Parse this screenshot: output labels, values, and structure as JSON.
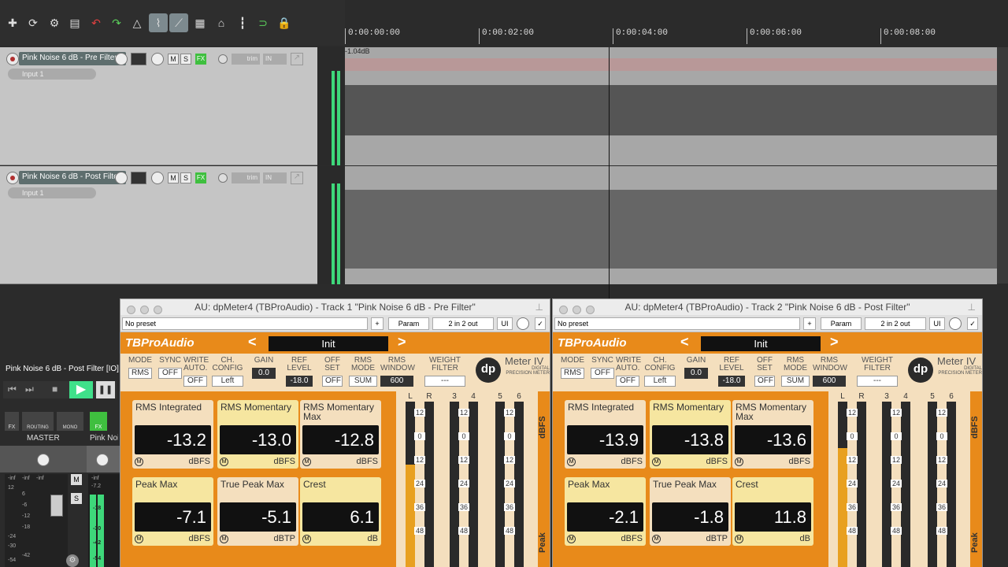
{
  "timeline": {
    "ticks": [
      "0:00:00:00",
      "0:00:02:00",
      "0:00:04:00",
      "0:00:06:00",
      "0:00:08:00"
    ],
    "peak_label": "-1.04dB"
  },
  "tracks": [
    {
      "name": "Pink Noise 6 dB - Pre Filter",
      "input": "Input 1",
      "number": "1",
      "m": "M",
      "s": "S",
      "fx": "FX",
      "trim": "trim",
      "in": "IN"
    },
    {
      "name": "Pink Noise 6 dB - Post Filter",
      "input": "Input 1",
      "number": "2",
      "m": "M",
      "s": "S",
      "fx": "FX",
      "trim": "trim",
      "in": "IN"
    }
  ],
  "mixer": {
    "track_name": "Pink Noise 6 dB - Post Filter [IO] r",
    "master_label": "MASTER",
    "strip2_label": "Pink Noi",
    "routing": "ROUTING",
    "mono": "MONO",
    "fx": "FX",
    "m": "M",
    "s": "S",
    "scale": [
      "-inf",
      "12",
      "6",
      "-6",
      "-12",
      "-18",
      "-24",
      "-30",
      "-42",
      "-54"
    ],
    "scale_right": [
      "-inf",
      "-7.2",
      "-18",
      "-30",
      "-42",
      "-54"
    ]
  },
  "plugins": [
    {
      "title": "AU: dpMeter4 (TBProAudio) - Track 1 \"Pink Noise 6 dB - Pre Filter\"",
      "preset": "No preset",
      "plus": "+",
      "param": "Param",
      "io": "2 in 2 out",
      "ui": "UI",
      "logo": "TBProAudio",
      "program": "Init",
      "prev": "<",
      "next": ">",
      "brand": "Meter IV",
      "brand_sub": "DIGITAL PRECISION METER",
      "dp": "dp",
      "controls": [
        {
          "label": "MODE",
          "value": "RMS"
        },
        {
          "label": "SYNC",
          "value": "OFF"
        },
        {
          "label": "WRITE AUTO.",
          "value": "OFF"
        },
        {
          "label": "CH. CONFIG",
          "value": "Left"
        },
        {
          "label": "GAIN",
          "value": "0.0"
        },
        {
          "label": "REF LEVEL",
          "value": "-18.0"
        },
        {
          "label": "OFF SET",
          "value": "OFF"
        },
        {
          "label": "RMS MODE",
          "value": "SUM"
        },
        {
          "label": "RMS WINDOW",
          "value": "600"
        },
        {
          "label": "WEIGHT FILTER",
          "value": "---"
        }
      ],
      "boxes": [
        {
          "label": "RMS Integrated",
          "value": "-13.2",
          "unit": "dBFS"
        },
        {
          "label": "RMS Momentary",
          "value": "-13.0",
          "unit": "dBFS"
        },
        {
          "label": "RMS Momentary Max",
          "value": "-12.8",
          "unit": "dBFS"
        },
        {
          "label": "Peak Max",
          "value": "-7.1",
          "unit": "dBFS"
        },
        {
          "label": "True Peak Max",
          "value": "-5.1",
          "unit": "dBTP"
        },
        {
          "label": "Crest",
          "value": "6.1",
          "unit": "dB"
        }
      ],
      "meter_channels": [
        "L",
        "R",
        "3",
        "4",
        "5",
        "6"
      ],
      "meter_scale": [
        "12",
        "0",
        "12",
        "24",
        "36",
        "48"
      ],
      "meter_fill": [
        0.62,
        0,
        0,
        0,
        0,
        0
      ],
      "side_top": "dBFS",
      "side_bottom": "Peak",
      "m_marker": "M"
    },
    {
      "title": "AU: dpMeter4 (TBProAudio) - Track 2 \"Pink Noise 6 dB - Post Filter\"",
      "preset": "No preset",
      "plus": "+",
      "param": "Param",
      "io": "2 in 2 out",
      "ui": "UI",
      "logo": "TBProAudio",
      "program": "Init",
      "prev": "<",
      "next": ">",
      "brand": "Meter IV",
      "brand_sub": "DIGITAL PRECISION METER",
      "dp": "dp",
      "controls": [
        {
          "label": "MODE",
          "value": "RMS"
        },
        {
          "label": "SYNC",
          "value": "OFF"
        },
        {
          "label": "WRITE AUTO.",
          "value": "OFF"
        },
        {
          "label": "CH. CONFIG",
          "value": "Left"
        },
        {
          "label": "GAIN",
          "value": "0.0"
        },
        {
          "label": "REF LEVEL",
          "value": "-18.0"
        },
        {
          "label": "OFF SET",
          "value": "OFF"
        },
        {
          "label": "RMS MODE",
          "value": "SUM"
        },
        {
          "label": "RMS WINDOW",
          "value": "600"
        },
        {
          "label": "WEIGHT FILTER",
          "value": "---"
        }
      ],
      "boxes": [
        {
          "label": "RMS Integrated",
          "value": "-13.9",
          "unit": "dBFS"
        },
        {
          "label": "RMS Momentary",
          "value": "-13.8",
          "unit": "dBFS"
        },
        {
          "label": "RMS Momentary Max",
          "value": "-13.6",
          "unit": "dBFS"
        },
        {
          "label": "Peak Max",
          "value": "-2.1",
          "unit": "dBFS"
        },
        {
          "label": "True Peak Max",
          "value": "-1.8",
          "unit": "dBTP"
        },
        {
          "label": "Crest",
          "value": "11.8",
          "unit": "dB"
        }
      ],
      "meter_channels": [
        "L",
        "R",
        "3",
        "4",
        "5",
        "6"
      ],
      "meter_scale": [
        "12",
        "0",
        "12",
        "24",
        "36",
        "48"
      ],
      "meter_fill": [
        0.72,
        0,
        0,
        0,
        0,
        0
      ],
      "side_top": "dBFS",
      "side_bottom": "Peak",
      "m_marker": "M"
    }
  ],
  "colors": {
    "accent": "#e88a1a",
    "panel": "#f4dfbe",
    "fx_on": "#3fbf3f"
  }
}
